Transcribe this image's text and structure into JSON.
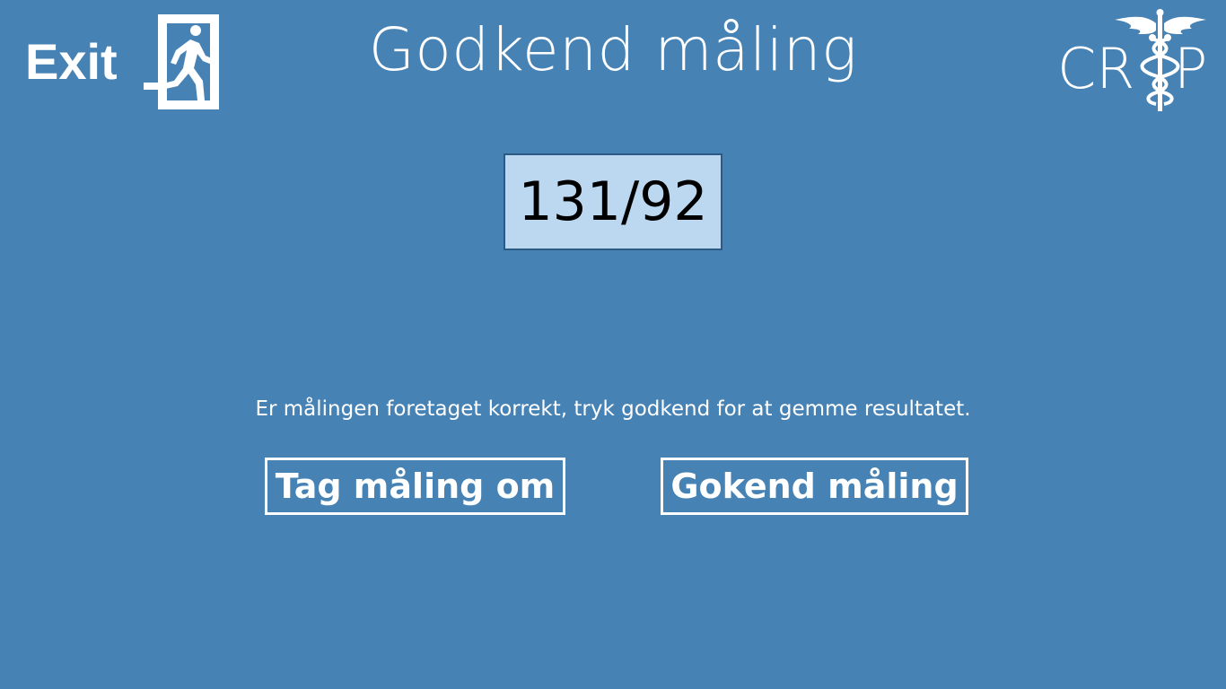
{
  "header": {
    "exit_label": "Exit",
    "title": "Godkend måling",
    "logo_left": "CR",
    "logo_right": "P"
  },
  "measurement": {
    "value": "131/92"
  },
  "instruction": "Er målingen foretaget korrekt, tryk godkend for at gemme resultatet.",
  "actions": {
    "retake_label": "Tag måling om",
    "approve_label": "Gokend måling"
  },
  "icons": {
    "exit": "exit-running-man-icon",
    "logo": "caduceus-icon"
  },
  "colors": {
    "background": "#4682b4",
    "reading_box": "#bcd8f0",
    "reading_border": "#2d5a85",
    "text": "#ffffff"
  }
}
